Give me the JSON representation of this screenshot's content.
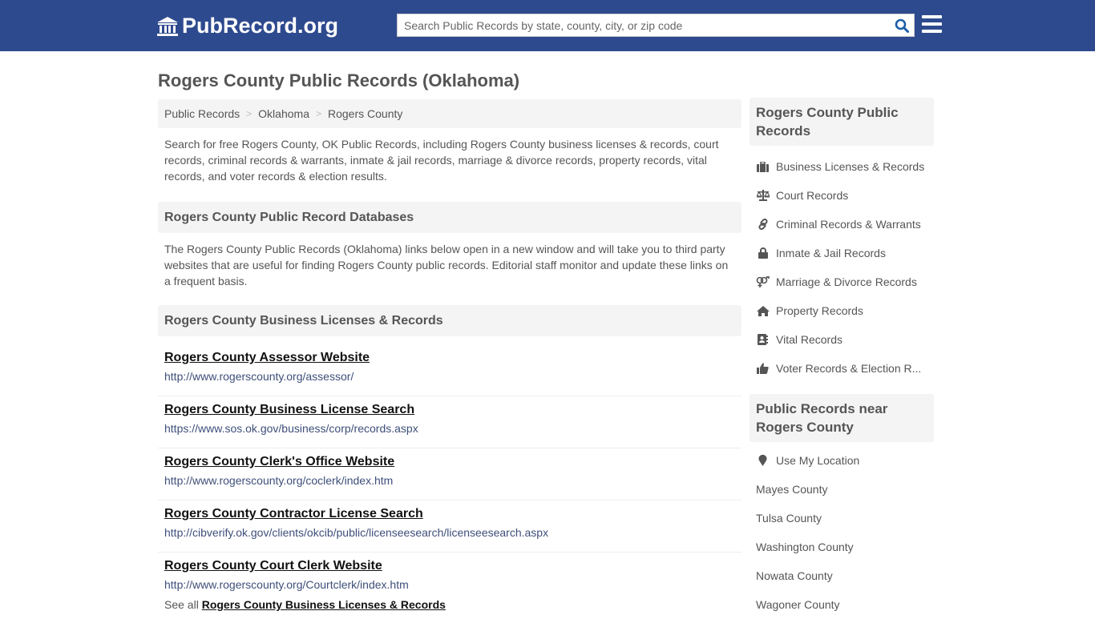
{
  "header": {
    "logo_text": "PubRecord.org",
    "search_placeholder": "Search Public Records by state, county, city, or zip code",
    "colors": {
      "header_bg": "#2e4a8f",
      "search_icon": "#1a5fa8"
    }
  },
  "page_title": "Rogers County Public Records (Oklahoma)",
  "breadcrumb": [
    "Public Records",
    "Oklahoma",
    "Rogers County"
  ],
  "breadcrumb_sep": ">",
  "intro": "Search for free Rogers County, OK Public Records, including Rogers County business licenses & records, court records, criminal records & warrants, inmate & jail records, marriage & divorce records, property records, vital records, and voter records & election results.",
  "databases": {
    "heading": "Rogers County Public Record Databases",
    "text": "The Rogers County Public Records (Oklahoma) links below open in a new window and will take you to third party websites that are useful for finding Rogers County public records. Editorial staff monitor and update these links on a frequent basis."
  },
  "business": {
    "heading": "Rogers County Business Licenses & Records",
    "links": [
      {
        "title": "Rogers County Assessor Website",
        "url": "http://www.rogerscounty.org/assessor/"
      },
      {
        "title": "Rogers County Business License Search",
        "url": "https://www.sos.ok.gov/business/corp/records.aspx"
      },
      {
        "title": "Rogers County Clerk's Office Website",
        "url": "http://www.rogerscounty.org/coclerk/index.htm"
      },
      {
        "title": "Rogers County Contractor License Search",
        "url": "http://cibverify.ok.gov/clients/okcib/public/licenseesearch/licenseesearch.aspx"
      },
      {
        "title": "Rogers County Court Clerk Website",
        "url": "http://www.rogerscounty.org/Courtclerk/index.htm"
      }
    ],
    "see_all_prefix": "See all",
    "see_all_link": "Rogers County Business Licenses & Records"
  },
  "sidebar": {
    "records_heading": "Rogers County Public Records",
    "records": [
      {
        "label": "Business Licenses & Records",
        "icon": "briefcase-icon"
      },
      {
        "label": "Court Records",
        "icon": "balance-scale-icon"
      },
      {
        "label": "Criminal Records & Warrants",
        "icon": "link-icon"
      },
      {
        "label": "Inmate & Jail Records",
        "icon": "lock-icon"
      },
      {
        "label": "Marriage & Divorce Records",
        "icon": "venus-mars-icon"
      },
      {
        "label": "Property Records",
        "icon": "home-icon"
      },
      {
        "label": "Vital Records",
        "icon": "address-book-icon"
      },
      {
        "label": "Voter Records & Election R...",
        "icon": "thumbs-up-icon"
      }
    ],
    "near_heading": "Public Records near Rogers County",
    "use_location": "Use My Location",
    "near": [
      "Mayes County",
      "Tulsa County",
      "Washington County",
      "Nowata County",
      "Wagoner County"
    ]
  }
}
